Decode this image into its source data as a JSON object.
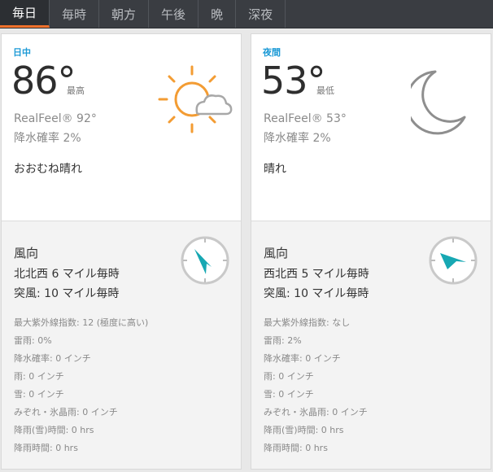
{
  "tabs": [
    {
      "label": "毎日",
      "active": true
    },
    {
      "label": "毎時",
      "active": false
    },
    {
      "label": "朝方",
      "active": false
    },
    {
      "label": "午後",
      "active": false
    },
    {
      "label": "晩",
      "active": false
    },
    {
      "label": "深夜",
      "active": false
    }
  ],
  "colors": {
    "accent": "#f0712c",
    "period": "#1c9ad6",
    "compass_arrow": "#17a8b3",
    "sun": "#f39c33"
  },
  "day": {
    "period": "日中",
    "temp": "86°",
    "hilo": "最高",
    "realfeel": "RealFeel® 92°",
    "precip": "降水確率 2%",
    "condition": "おおむね晴れ",
    "icon": "partly-sunny-icon",
    "wind_title": "風向",
    "wind_speed": "北北西 6 マイル毎時",
    "wind_gust": "突風: 10 マイル毎時",
    "wind_direction": "NNW",
    "details": [
      "最大紫外線指数: 12 (極度に高い)",
      "雷雨: 0%",
      "降水確率: 0 インチ",
      "雨: 0 インチ",
      "雪: 0 インチ",
      "みぞれ・氷晶雨: 0 インチ",
      "降雨(雪)時間: 0 hrs",
      "降雨時間: 0 hrs"
    ]
  },
  "night": {
    "period": "夜間",
    "temp": "53°",
    "hilo": "最低",
    "realfeel": "RealFeel® 53°",
    "precip": "降水確率 2%",
    "condition": "晴れ",
    "icon": "moon-icon",
    "wind_title": "風向",
    "wind_speed": "西北西 5 マイル毎時",
    "wind_gust": "突風: 10 マイル毎時",
    "wind_direction": "WNW",
    "details": [
      "最大紫外線指数: なし",
      "雷雨: 2%",
      "降水確率: 0 インチ",
      "雨: 0 インチ",
      "雪: 0 インチ",
      "みぞれ・氷晶雨: 0 インチ",
      "降雨(雪)時間: 0 hrs",
      "降雨時間: 0 hrs"
    ]
  }
}
